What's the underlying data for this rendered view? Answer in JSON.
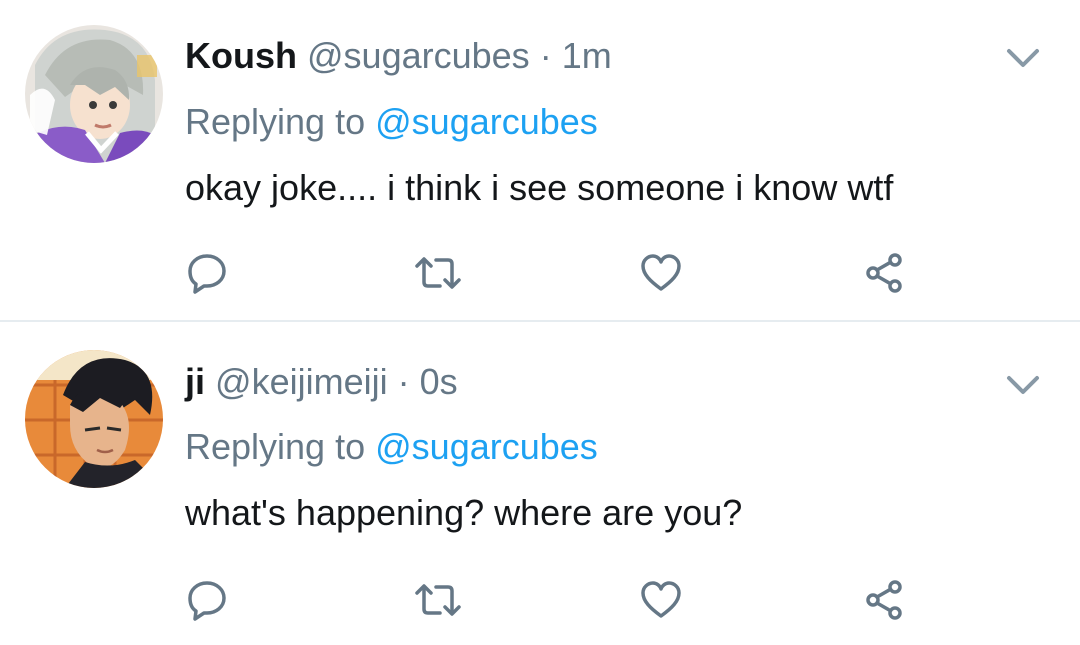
{
  "tweets": [
    {
      "name": "Koush",
      "handle": "@sugarcubes",
      "separator": "·",
      "time": "1m",
      "replying_prefix": "Replying to",
      "replying_to": "@sugarcubes",
      "text": "okay joke.... i think i see someone i know wtf",
      "avatar_icon": "anime-avatar-gray-hair",
      "actions": [
        "reply-icon",
        "retweet-icon",
        "like-icon",
        "share-icon"
      ]
    },
    {
      "name": "ji",
      "handle": "@keijimeiji",
      "separator": "·",
      "time": "0s",
      "replying_prefix": "Replying to",
      "replying_to": "@sugarcubes",
      "text": "what's happening? where are you?",
      "avatar_icon": "anime-avatar-dark-hair",
      "actions": [
        "reply-icon",
        "retweet-icon",
        "like-icon",
        "share-icon"
      ]
    }
  ],
  "colors": {
    "text": "#14171a",
    "secondary": "#657786",
    "link": "#1da1f2",
    "divider": "#e6ecf0",
    "icon": "#657786"
  }
}
